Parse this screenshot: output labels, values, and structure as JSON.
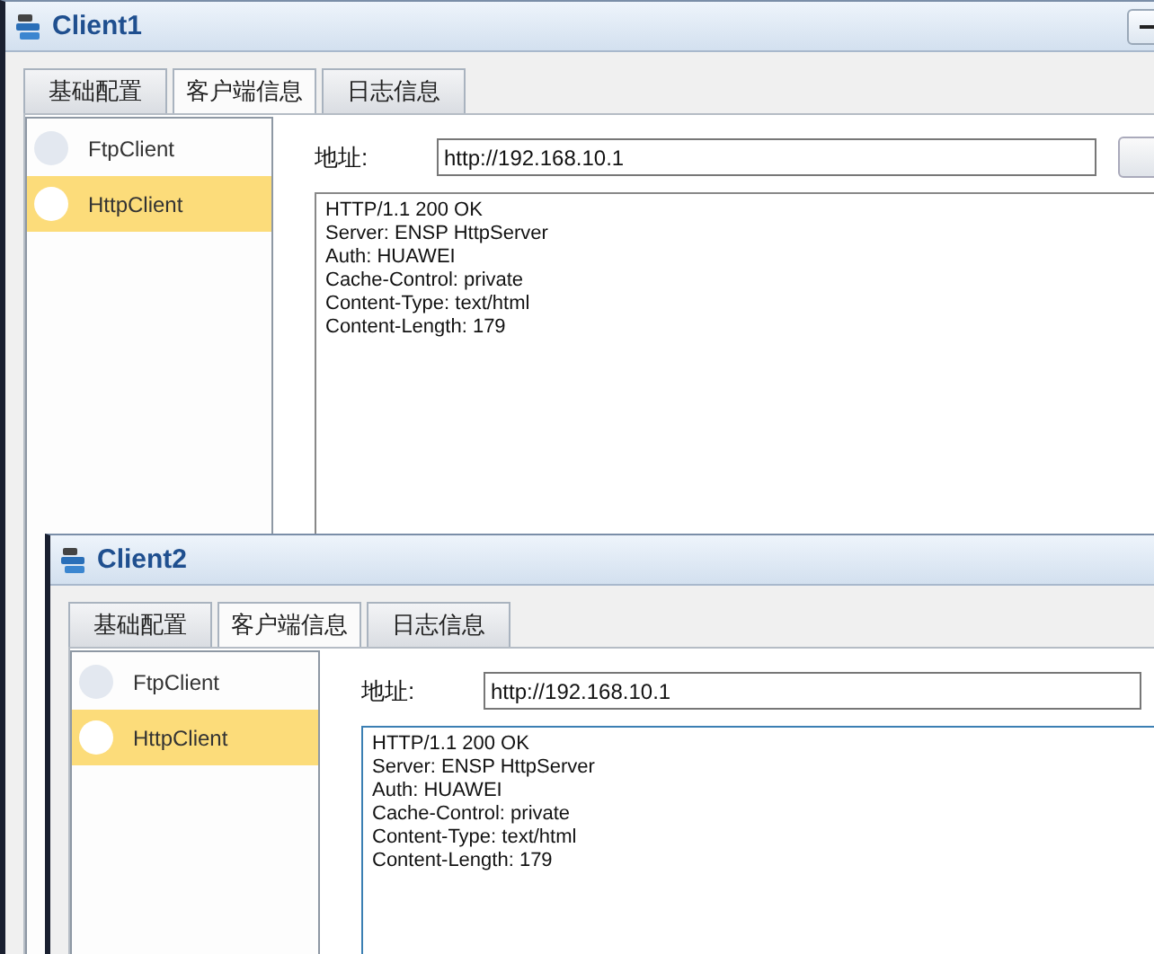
{
  "windows": [
    {
      "title": "Client1",
      "has_minimize": true,
      "has_action_button": true,
      "tabs": [
        {
          "label": "基础配置",
          "selected": false
        },
        {
          "label": "客户端信息",
          "selected": true
        },
        {
          "label": "日志信息",
          "selected": false
        }
      ],
      "clients": [
        {
          "label": "FtpClient",
          "selected": false
        },
        {
          "label": "HttpClient",
          "selected": true
        }
      ],
      "address": {
        "label": "地址:",
        "value": "http://192.168.10.1"
      },
      "response": {
        "focused": false,
        "lines": [
          "HTTP/1.1 200 OK",
          "Server: ENSP HttpServer",
          "Auth: HUAWEI",
          "Cache-Control: private",
          "Content-Type: text/html",
          "Content-Length: 179"
        ]
      }
    },
    {
      "title": "Client2",
      "has_minimize": false,
      "has_action_button": false,
      "tabs": [
        {
          "label": "基础配置",
          "selected": false
        },
        {
          "label": "客户端信息",
          "selected": true
        },
        {
          "label": "日志信息",
          "selected": false
        }
      ],
      "clients": [
        {
          "label": "FtpClient",
          "selected": false
        },
        {
          "label": "HttpClient",
          "selected": true
        }
      ],
      "address": {
        "label": "地址:",
        "value": "http://192.168.10.1"
      },
      "response": {
        "focused": true,
        "lines": [
          "HTTP/1.1 200 OK",
          "Server: ENSP HttpServer",
          "Auth: HUAWEI",
          "Cache-Control: private",
          "Content-Type: text/html",
          "Content-Length: 179"
        ]
      }
    }
  ]
}
